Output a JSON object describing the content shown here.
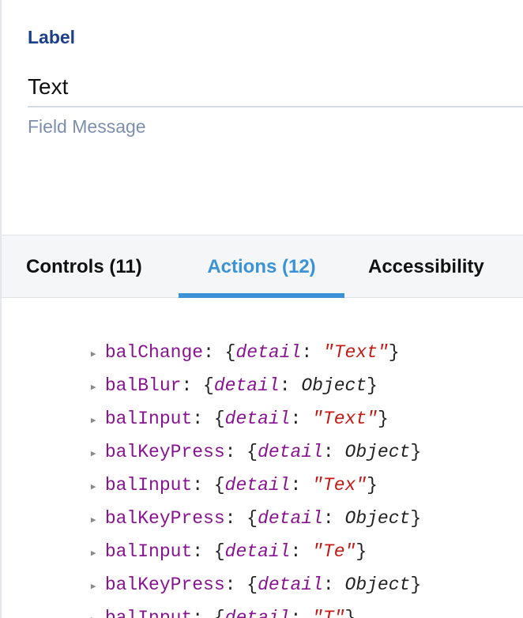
{
  "field": {
    "label": "Label",
    "value": "Text",
    "message": "Field Message"
  },
  "tabs": [
    {
      "label": "Controls (11)",
      "active": false
    },
    {
      "label": "Actions (12)",
      "active": true
    },
    {
      "label": "Accessibility",
      "active": false
    }
  ],
  "colors": {
    "label": "#1c3f8c",
    "message": "#7d8fac",
    "active_tab": "#3b93d5",
    "event_name": "#881391",
    "string_value": "#c41a16"
  },
  "actions": [
    {
      "name": "balChange",
      "key": "detail",
      "value": "\"Text\"",
      "type": "string"
    },
    {
      "name": "balBlur",
      "key": "detail",
      "value": "Object",
      "type": "object"
    },
    {
      "name": "balInput",
      "key": "detail",
      "value": "\"Text\"",
      "type": "string"
    },
    {
      "name": "balKeyPress",
      "key": "detail",
      "value": "Object",
      "type": "object"
    },
    {
      "name": "balInput",
      "key": "detail",
      "value": "\"Tex\"",
      "type": "string"
    },
    {
      "name": "balKeyPress",
      "key": "detail",
      "value": "Object",
      "type": "object"
    },
    {
      "name": "balInput",
      "key": "detail",
      "value": "\"Te\"",
      "type": "string"
    },
    {
      "name": "balKeyPress",
      "key": "detail",
      "value": "Object",
      "type": "object"
    },
    {
      "name": "balInput",
      "key": "detail",
      "value": "\"T\"",
      "type": "string"
    }
  ]
}
